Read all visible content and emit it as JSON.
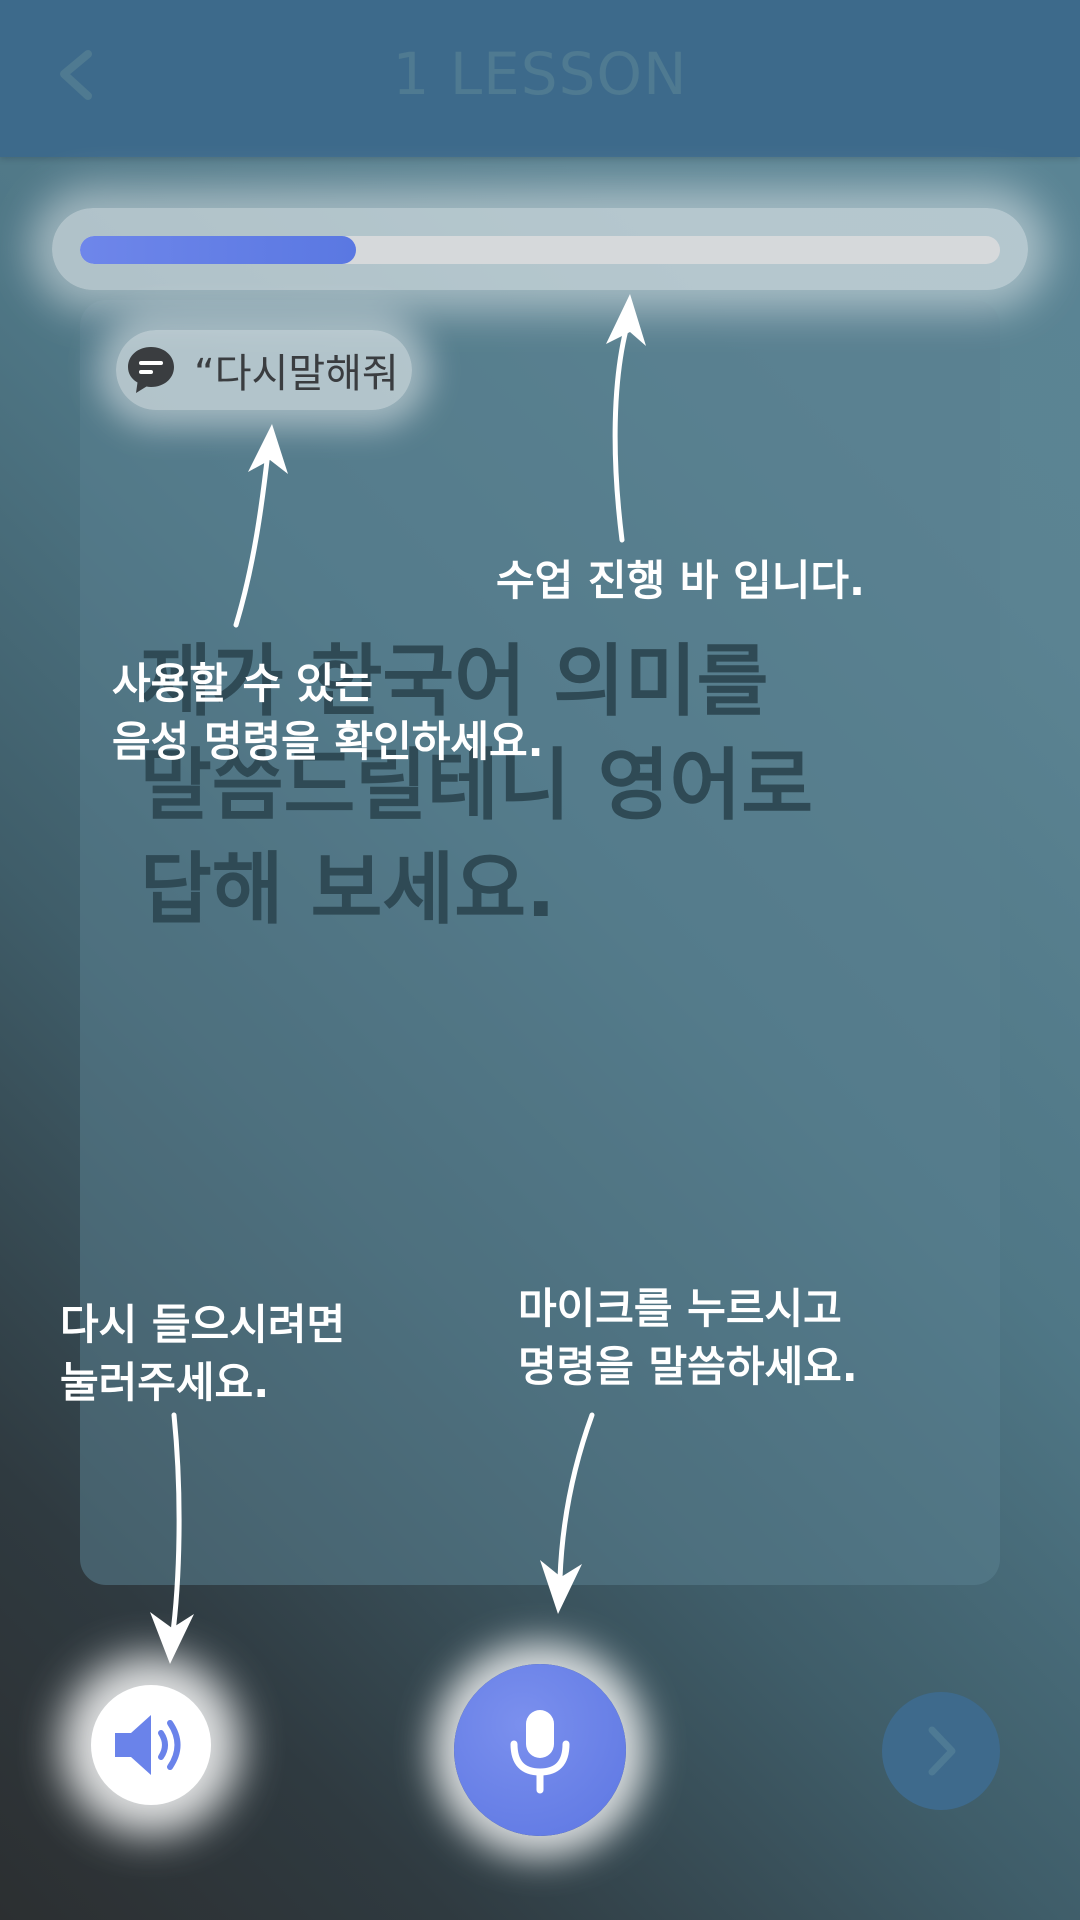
{
  "header": {
    "title": "1 LESSON"
  },
  "progress": {
    "fraction": 0.3
  },
  "voice_command": {
    "icon": "speech-bubble-icon",
    "text": "“다시말해줘"
  },
  "prompt": {
    "lines": [
      "제가 한국어 의미를",
      "말씀드릴테니 영어로",
      "답해 보세요."
    ]
  },
  "annotations": {
    "progress_bar": "수업 진행 바 입니다.",
    "voice_commands": [
      "사용할 수 있는",
      "음성 명령을 확인하세요."
    ],
    "replay": [
      "다시 들으시려면",
      "눌러주세요."
    ],
    "mic": [
      "마이크를 누르시고",
      "명령을 말씀하세요."
    ]
  },
  "controls": {
    "speaker_icon": "speaker-icon",
    "mic_icon": "microphone-icon",
    "next_icon": "chevron-right-icon"
  },
  "colors": {
    "header": "#3d6a8b",
    "accent": "#5a78e2",
    "progress_track": "#d6d9db"
  }
}
